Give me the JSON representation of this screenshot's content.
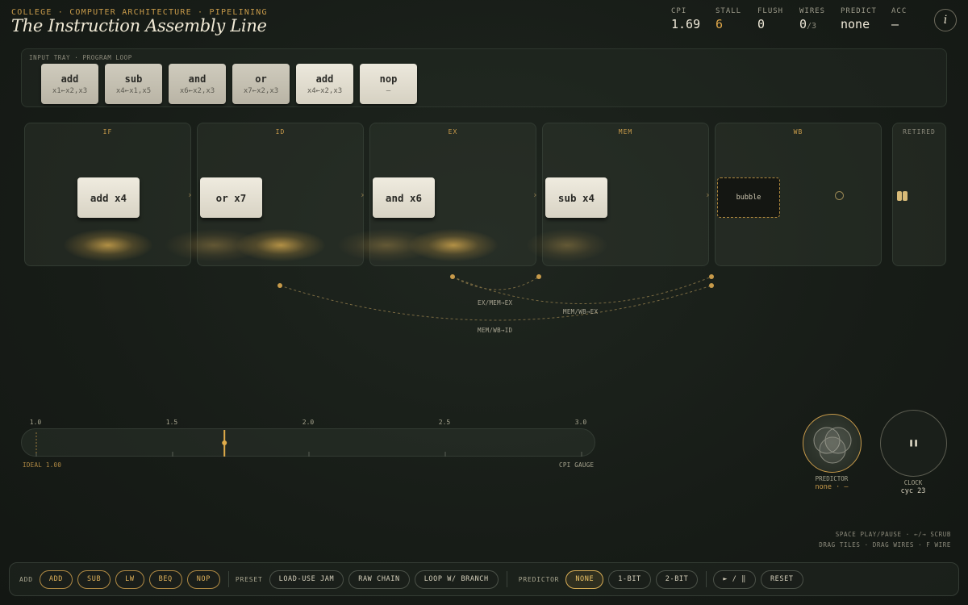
{
  "header": {
    "breadcrumb": "COLLEGE · COMPUTER ARCHITECTURE · PIPELINING",
    "title": "The Instruction Assembly Line",
    "info_icon": "italic-i-info-icon"
  },
  "stats": [
    {
      "label": "CPI",
      "value": "1.69",
      "suffix": ""
    },
    {
      "label": "STALL",
      "value": "6",
      "suffix": ""
    },
    {
      "label": "FLUSH",
      "value": "0",
      "suffix": ""
    },
    {
      "label": "WIRES",
      "value": "0",
      "suffix": "/3"
    },
    {
      "label": "PREDICT",
      "value": "none",
      "suffix": ""
    },
    {
      "label": "ACC",
      "value": "—",
      "suffix": ""
    }
  ],
  "tray": {
    "label": "INPUT TRAY · PROGRAM LOOP",
    "tiles": [
      {
        "op": "add",
        "args": "x1←x2,x3"
      },
      {
        "op": "sub",
        "args": "x4←x1,x5"
      },
      {
        "op": "and",
        "args": "x6←x2,x3"
      },
      {
        "op": "or",
        "args": "x7←x2,x3"
      },
      {
        "op": "add",
        "args": "x4←x2,x3"
      },
      {
        "op": "nop",
        "args": "—"
      }
    ]
  },
  "stages": [
    {
      "label": "IF",
      "chip": "add x4"
    },
    {
      "label": "ID",
      "chip": "or x7"
    },
    {
      "label": "EX",
      "chip": "and x6"
    },
    {
      "label": "MEM",
      "chip": "sub x4"
    },
    {
      "label": "WB",
      "chip": "bubble"
    },
    {
      "label": "RETIRED",
      "chip": ""
    }
  ],
  "forwarding": {
    "labels": [
      "EX/MEM→EX",
      "MEM/WB→EX",
      "MEM/WB→ID"
    ]
  },
  "gauge": {
    "ticks": [
      "1.0",
      "1.5",
      "2.0",
      "2.5",
      "3.0"
    ],
    "min": 1.0,
    "max": 3.0,
    "cpi": 1.69,
    "ideal_label": "IDEAL 1.00",
    "title": "CPI GAUGE"
  },
  "predictor_knob": {
    "label": "PREDICTOR",
    "value": "none · —"
  },
  "clock_knob": {
    "label": "CLOCK",
    "value": "cyc 23",
    "icon": "pause-icon"
  },
  "shortcuts": {
    "line1": "SPACE PLAY/PAUSE · ←/→ SCRUB",
    "line2": "DRAG TILES · DRAG WIRES · F WIRE"
  },
  "toolbar": {
    "add_label": "ADD",
    "add_buttons": [
      "ADD",
      "SUB",
      "LW",
      "BEQ",
      "NOP"
    ],
    "preset_label": "PRESET",
    "presets": [
      "LOAD-USE JAM",
      "RAW CHAIN",
      "LOOP W/ BRANCH"
    ],
    "predictor_label": "PREDICTOR",
    "predictors": [
      "NONE",
      "1-BIT",
      "2-BIT"
    ],
    "predictor_selected": "NONE",
    "play_pause": "► / ‖",
    "reset": "RESET"
  },
  "colors": {
    "accent": "#c79a4a",
    "background": "#1a201a",
    "tile": "#e6e1d3"
  }
}
